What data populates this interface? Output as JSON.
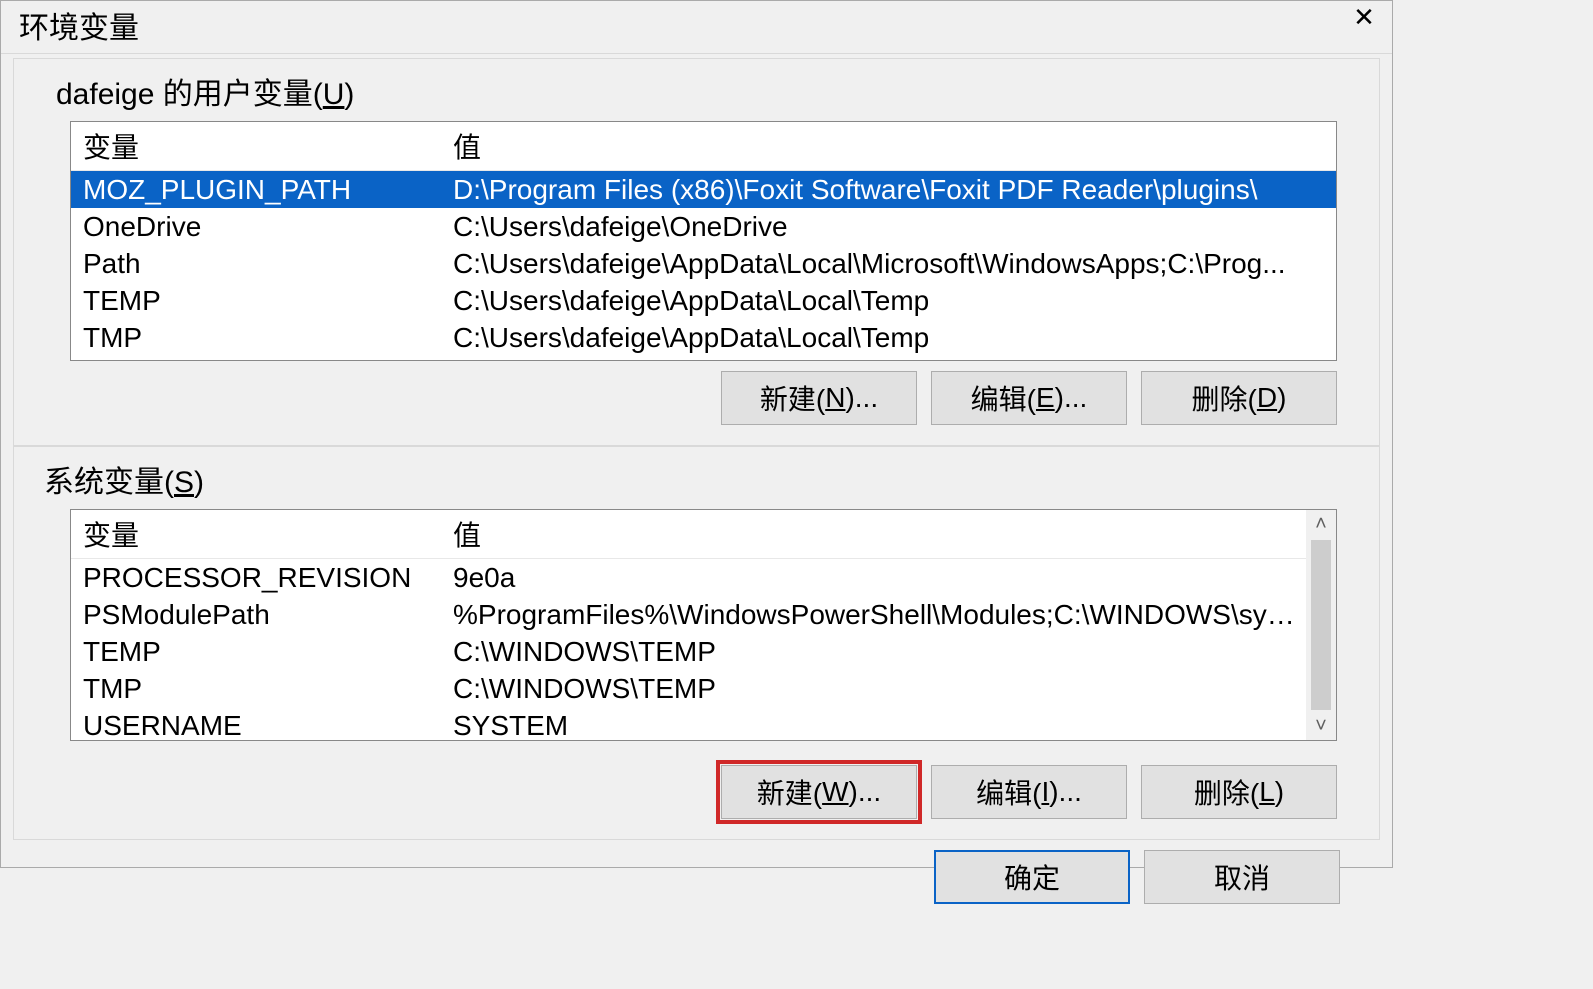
{
  "window": {
    "title": "环境变量"
  },
  "close_glyph": "✕",
  "user_section": {
    "label_pre": "dafeige 的用户变量(",
    "label_key": "U",
    "label_post": ")"
  },
  "columns": {
    "variable": "变量",
    "value": "值"
  },
  "user_vars": [
    {
      "name": "MOZ_PLUGIN_PATH",
      "value": "D:\\Program Files (x86)\\Foxit Software\\Foxit PDF Reader\\plugins\\",
      "selected": true
    },
    {
      "name": "OneDrive",
      "value": "C:\\Users\\dafeige\\OneDrive",
      "selected": false
    },
    {
      "name": "Path",
      "value": "C:\\Users\\dafeige\\AppData\\Local\\Microsoft\\WindowsApps;C:\\Prog...",
      "selected": false
    },
    {
      "name": "TEMP",
      "value": "C:\\Users\\dafeige\\AppData\\Local\\Temp",
      "selected": false
    },
    {
      "name": "TMP",
      "value": "C:\\Users\\dafeige\\AppData\\Local\\Temp",
      "selected": false
    }
  ],
  "user_buttons": {
    "new_pre": "新建(",
    "new_key": "N",
    "new_post": ")...",
    "edit_pre": "编辑(",
    "edit_key": "E",
    "edit_post": ")...",
    "delete_pre": "删除(",
    "delete_key": "D",
    "delete_post": ")"
  },
  "system_section": {
    "label_pre": "系统变量(",
    "label_key": "S",
    "label_post": ")"
  },
  "system_vars": [
    {
      "name": "PROCESSOR_REVISION",
      "value": "9e0a"
    },
    {
      "name": "PSModulePath",
      "value": "%ProgramFiles%\\WindowsPowerShell\\Modules;C:\\WINDOWS\\sys..."
    },
    {
      "name": "TEMP",
      "value": "C:\\WINDOWS\\TEMP"
    },
    {
      "name": "TMP",
      "value": "C:\\WINDOWS\\TEMP"
    },
    {
      "name": "USERNAME",
      "value": "SYSTEM"
    }
  ],
  "system_buttons": {
    "new_pre": "新建(",
    "new_key": "W",
    "new_post": ")...",
    "edit_pre": "编辑(",
    "edit_key": "I",
    "edit_post": ")...",
    "delete_pre": "删除(",
    "delete_key": "L",
    "delete_post": ")"
  },
  "dialog_buttons": {
    "ok": "确定",
    "cancel": "取消"
  },
  "scroll": {
    "up": "˄",
    "down": "˅"
  }
}
